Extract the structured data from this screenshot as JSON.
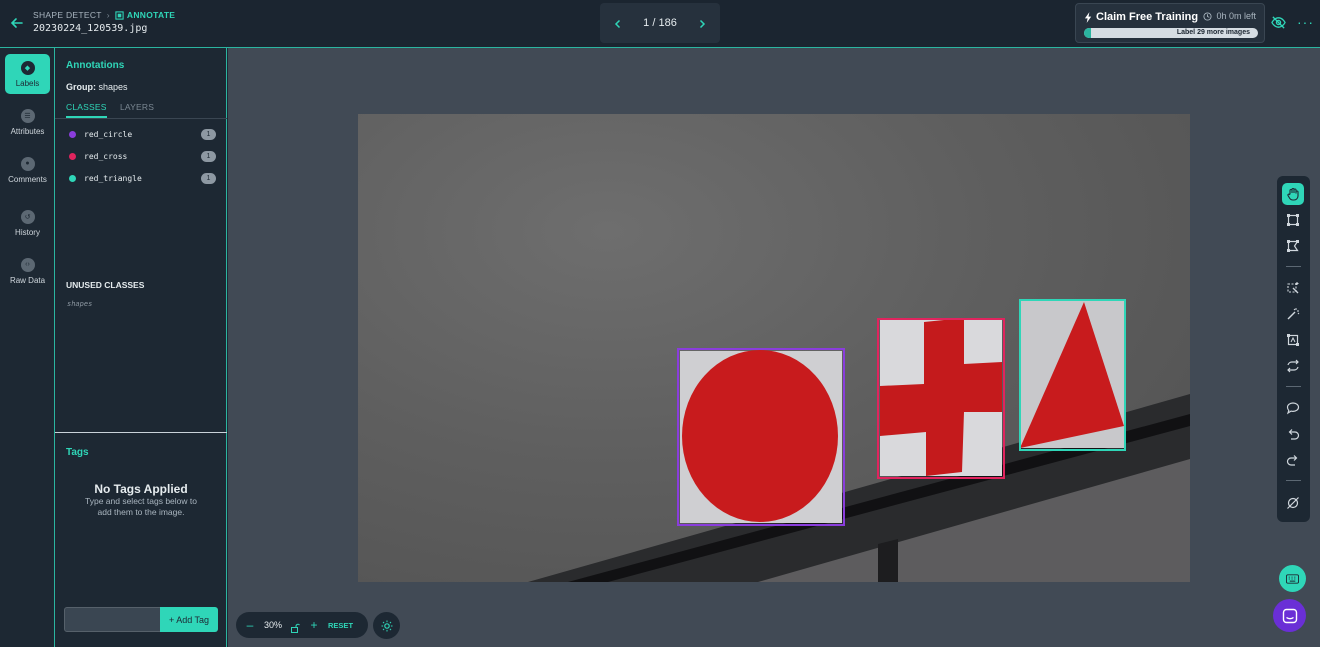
{
  "header": {
    "breadcrumb_root": "SHAPE DETECT",
    "breadcrumb_current": "ANNOTATE",
    "filename": "20230224_120539.jpg",
    "pager_text": "1 / 186",
    "promo_title": "Claim Free Training",
    "promo_time": "0h 0m left",
    "promo_bar_text": "Label 29 more images",
    "accent_color": "#2fd6b8"
  },
  "rail": {
    "items": [
      {
        "label": "Labels",
        "icon": "tag-icon"
      },
      {
        "label": "Attributes",
        "icon": "list-icon"
      },
      {
        "label": "Comments",
        "icon": "comment-icon"
      },
      {
        "label": "History",
        "icon": "history-icon"
      },
      {
        "label": "Raw Data",
        "icon": "code-icon"
      }
    ]
  },
  "panel": {
    "title": "Annotations",
    "group_label": "Group:",
    "group_value": "shapes",
    "tabs": [
      "CLASSES",
      "LAYERS"
    ],
    "classes": [
      {
        "name": "red_circle",
        "count": "1",
        "color": "#8a3ddc"
      },
      {
        "name": "red_cross",
        "count": "1",
        "color": "#e0245e"
      },
      {
        "name": "red_triangle",
        "count": "1",
        "color": "#2fd6b8"
      }
    ],
    "unused_title": "UNUSED CLASSES",
    "unused_items": [
      "shapes"
    ],
    "tags_title": "Tags",
    "no_tags_title": "No Tags Applied",
    "no_tags_help": "Type and select tags below to add them to the image.",
    "tag_input_value": "",
    "add_tag_label": "+ Add Tag"
  },
  "canvas": {
    "annotations": [
      {
        "class": "red_circle",
        "color": "#8a3ddc"
      },
      {
        "class": "red_cross",
        "color": "#e0245e"
      },
      {
        "class": "red_triangle",
        "color": "#2fd6b8"
      }
    ]
  },
  "zoom": {
    "minus": "–",
    "value": "30%",
    "plus": "+",
    "reset": "RESET"
  }
}
